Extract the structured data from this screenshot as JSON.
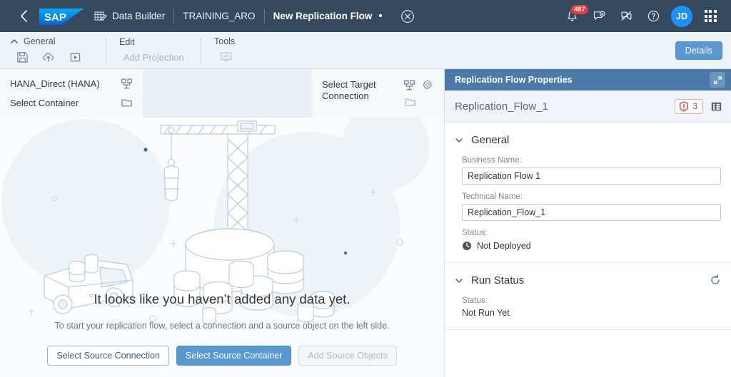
{
  "shellbar": {
    "back_icon": "chevron-left-icon",
    "logo_text": "SAP",
    "breadcrumb": [
      {
        "icon": "data-builder-icon",
        "label": "Data Builder"
      },
      {
        "icon": "",
        "label": "TRAINING_ARO"
      },
      {
        "icon": "",
        "label": "New Replication Flow",
        "dirty": "•"
      }
    ],
    "close_icon": "close-circle-icon",
    "notifications": {
      "icon": "bell-icon",
      "badge": "487"
    },
    "feedback_icon": "feedback-icon",
    "collaboration_icon": "collaboration-off-icon",
    "help_icon": "help-icon",
    "avatar_initials": "JD",
    "app_grid_icon": "app-grid-icon"
  },
  "toolbar": {
    "collapse_icon": "chevron-up-icon",
    "groups": [
      {
        "title": "General",
        "buttons": [
          {
            "name": "save-button",
            "icon": "save-icon",
            "disabled": false
          },
          {
            "name": "deploy-button",
            "icon": "cloud-upload-icon",
            "disabled": false
          },
          {
            "name": "run-button",
            "icon": "play-box-icon",
            "disabled": false
          }
        ]
      },
      {
        "title": "Edit",
        "label": "Add Projection",
        "disabled": true
      },
      {
        "title": "Tools",
        "buttons": [
          {
            "name": "impact-lineage-button",
            "icon": "monitor-chart-icon",
            "disabled": true
          }
        ]
      }
    ],
    "details_label": "Details"
  },
  "connections": {
    "source": {
      "connection_label": "HANA_Direct (HANA)",
      "connection_icon": "connection-icon",
      "container_label": "Select Container",
      "container_icon": "folder-icon"
    },
    "target": {
      "connection_label": "Select Target Connection",
      "connection_icon": "connection-icon",
      "settings_icon": "gear-icon",
      "container_icon": "folder-icon"
    }
  },
  "canvas": {
    "illustration": "construction-crane-database-illustration",
    "empty_title": "It looks like you haven’t added any data yet.",
    "empty_subtitle": "To start your replication flow, select a connection and a source object on the left side.",
    "actions": [
      {
        "name": "select-source-connection-button",
        "label": "Select Source Connection",
        "style": "default",
        "disabled": false
      },
      {
        "name": "select-source-container-button",
        "label": "Select Source Container",
        "style": "emphasized",
        "disabled": false
      },
      {
        "name": "add-source-objects-button",
        "label": "Add Source Objects",
        "style": "default",
        "disabled": true
      }
    ]
  },
  "properties": {
    "panel_title": "Replication Flow Properties",
    "expand_icon": "expand-icon",
    "object_name": "Replication_Flow_1",
    "error_badge": {
      "icon": "error-shield-icon",
      "count": "3"
    },
    "table_icon": "table-icon",
    "sections": [
      {
        "title": "General",
        "chevron": "chevron-down-icon",
        "fields": [
          {
            "label": "Business Name:",
            "value": "Replication Flow 1",
            "name": "business-name-field"
          },
          {
            "label": "Technical Name:",
            "value": "Replication_Flow_1",
            "name": "technical-name-field"
          }
        ],
        "status_label": "Status:",
        "status_value": "Not Deployed",
        "status_icon": "clock-icon"
      },
      {
        "title": "Run Status",
        "chevron": "chevron-down-icon",
        "refresh_icon": "refresh-icon",
        "status_label": "Status:",
        "status_value": "Not Run Yet"
      }
    ]
  },
  "colors": {
    "shellbar": "#354a5f",
    "accent_blue": "#5899d4",
    "panel_header": "#4a7aa7",
    "badge_red": "#ee3939",
    "error_red": "#d03c3c",
    "avatar_blue": "#1b90ff",
    "illustration_line": "#b9cde0"
  }
}
